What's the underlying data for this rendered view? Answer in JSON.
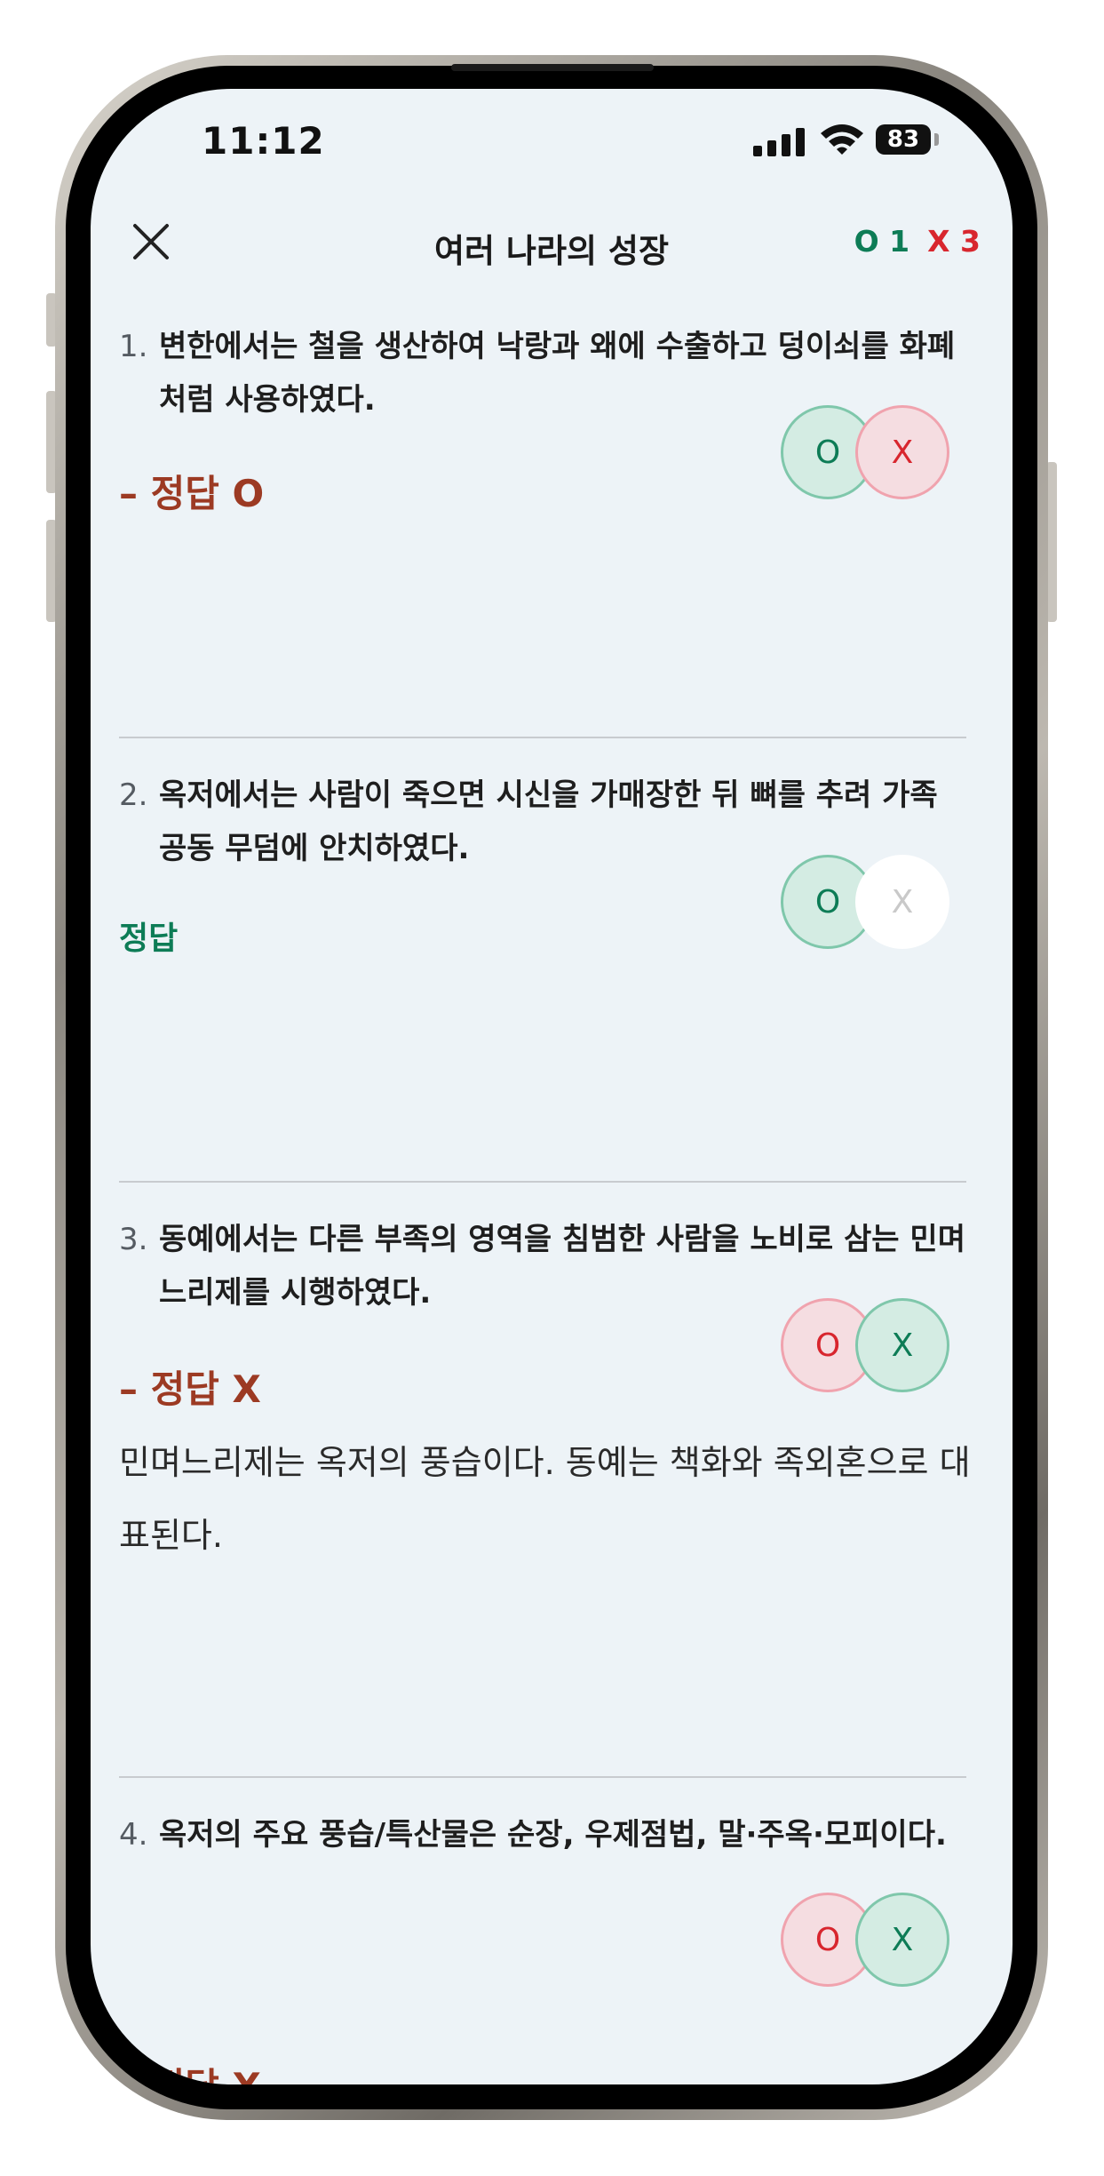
{
  "status_bar": {
    "time": "11:12",
    "battery": "83"
  },
  "header": {
    "title": "여러 나라의 성장",
    "score_correct": "O 1",
    "score_wrong": "X 3"
  },
  "questions": [
    {
      "number": "1.",
      "text": "변한에서는 철을 생산하여 낙랑과 왜에 수출하고 덩이쇠를 화폐처럼 사용하였다.",
      "o_label": "O",
      "x_label": "X",
      "result": "– 정답 O",
      "explanation": ""
    },
    {
      "number": "2.",
      "text": "옥저에서는 사람이 죽으면 시신을 가매장한 뒤 뼈를 추려 가족 공동 무덤에 안치하였다.",
      "o_label": "O",
      "x_label": "X",
      "result": "정답",
      "explanation": ""
    },
    {
      "number": "3.",
      "text": "동예에서는 다른 부족의 영역을 침범한 사람을 노비로 삼는 민며느리제를 시행하였다.",
      "o_label": "O",
      "x_label": "X",
      "result": "– 정답 X",
      "explanation": "민며느리제는 옥저의 풍습이다. 동예는 책화와 족외혼으로 대표된다."
    },
    {
      "number": "4.",
      "text": "옥저의 주요 풍습/특산물은 순장, 우제점법, 말·주옥·모피이다.",
      "o_label": "O",
      "x_label": "X",
      "result": "– 정답 X",
      "explanation": ""
    }
  ],
  "colors": {
    "correct": "#0d7c56",
    "wrong": "#d8262e",
    "result_wrong": "#9c3a23",
    "screen_bg": "#edf3f7"
  }
}
